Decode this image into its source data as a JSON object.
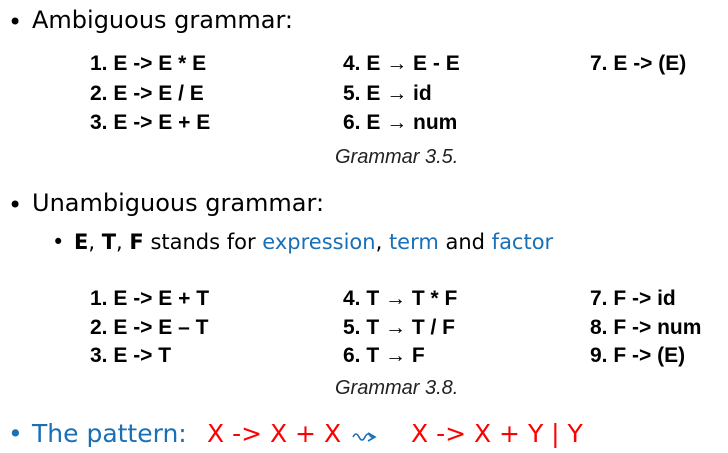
{
  "bullet_char": "•",
  "sub_bullet_char": "•",
  "section1": {
    "heading": "Ambiguous grammar:",
    "rules_col1": [
      "1.  E -> E * E",
      "2.  E -> E / E",
      "3.  E -> E + E"
    ],
    "rules_col2": [
      "4.  E → E - E",
      "5.  E → id",
      "6.  E → num"
    ],
    "rules_col3": [
      "7. E -> (E)"
    ],
    "caption": "Grammar 3.5."
  },
  "section2": {
    "heading": "Unambiguous grammar:",
    "sub": {
      "e": "E",
      "comma1": ", ",
      "t": "T",
      "comma2": ", ",
      "f": "F",
      "stands_for": " stands for ",
      "expression": "expression",
      "comma3": ", ",
      "term": "term",
      "and": " and ",
      "factor": "factor"
    },
    "rules_col1": [
      "1.   E -> E + T",
      "2.   E -> E – T",
      "3.   E -> T"
    ],
    "rules_col2": [
      "4.  T → T * F",
      "5.  T → T / F",
      "6.  T → F"
    ],
    "rules_col3": [
      "7. F -> id",
      "8. F -> num",
      "9. F -> (E)"
    ],
    "caption": "Grammar 3.8."
  },
  "pattern": {
    "label": "The pattern:",
    "from": "X -> X + X",
    "arrow_icon": "squiggly-arrow",
    "to": "X -> X + Y | Y"
  }
}
